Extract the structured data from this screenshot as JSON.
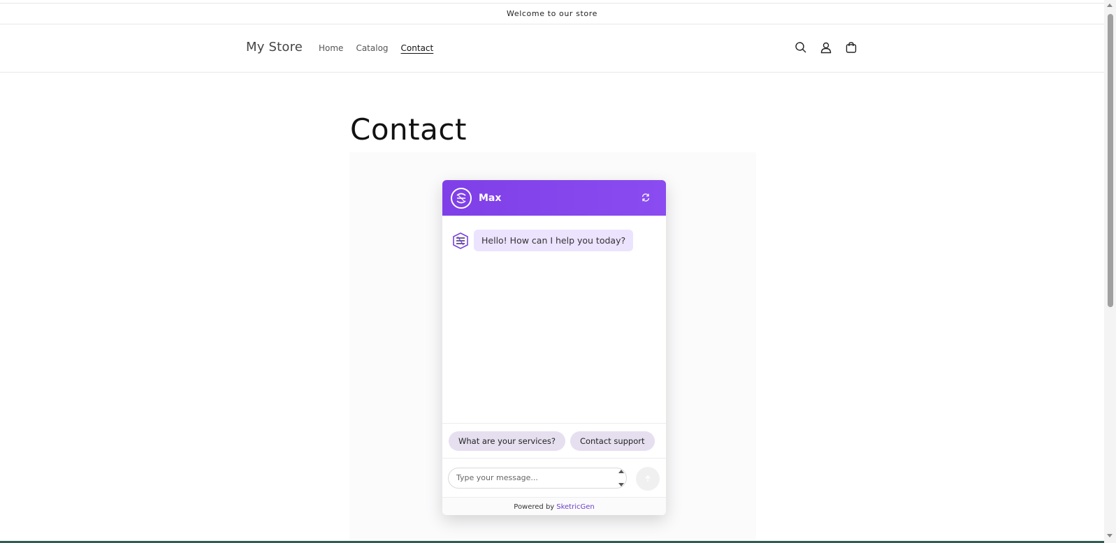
{
  "announcement": {
    "text": "Welcome to our store"
  },
  "header": {
    "logo": "My Store",
    "nav": [
      {
        "label": "Home",
        "active": false
      },
      {
        "label": "Catalog",
        "active": false
      },
      {
        "label": "Contact",
        "active": true
      }
    ],
    "icons": [
      "search-icon",
      "account-icon",
      "cart-icon"
    ]
  },
  "page": {
    "title": "Contact"
  },
  "chat": {
    "bot_name": "Max",
    "header_color": "#7f3fe8",
    "message": "Hello! How can I help you today?",
    "suggestions": [
      "What are your services?",
      "Contact support"
    ],
    "input_placeholder": "Type your message...",
    "footer_prefix": "Powered by",
    "footer_brand": "SketricGen"
  }
}
